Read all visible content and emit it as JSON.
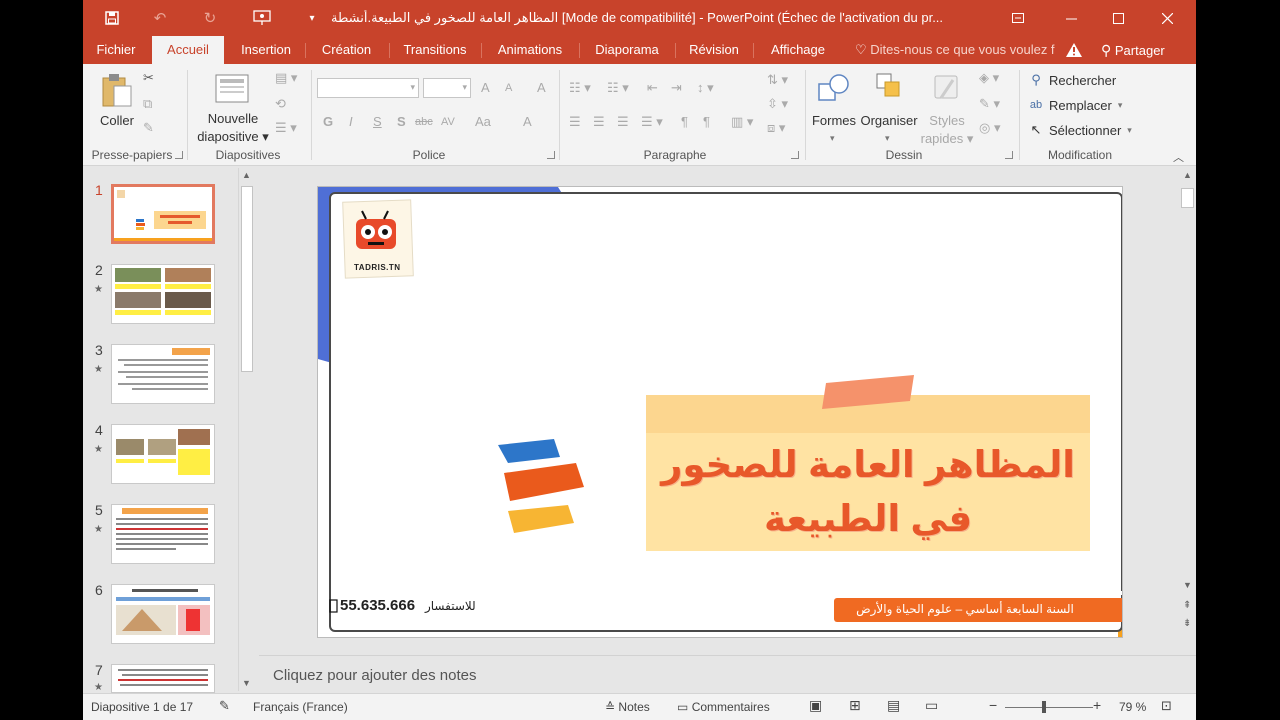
{
  "window": {
    "title": "المظاهر العامة للصخور في الطبيعة.أنشطة [Mode de compatibilité] - PowerPoint (Échec de l'activation du pr...",
    "accent": "#c8432b"
  },
  "qat": {
    "save_icon": "save-icon",
    "undo_icon": "undo-icon",
    "redo_icon": "redo-icon",
    "present_icon": "start-from-beginning-icon",
    "customize_icon": "customize-qat-icon"
  },
  "tabs": [
    {
      "label": "Fichier"
    },
    {
      "label": "Accueil"
    },
    {
      "label": "Insertion"
    },
    {
      "label": "Création"
    },
    {
      "label": "Transitions"
    },
    {
      "label": "Animations"
    },
    {
      "label": "Diaporama"
    },
    {
      "label": "Révision"
    },
    {
      "label": "Affichage"
    }
  ],
  "tellme": "Dites-nous ce que vous voulez f",
  "share": "Partager",
  "ribbon": {
    "clipboard": {
      "paste": "Coller",
      "label": "Presse-papiers"
    },
    "slides": {
      "new_line1": "Nouvelle",
      "new_line2": "diapositive",
      "label": "Diapositives"
    },
    "font": {
      "bold": "G",
      "italic": "I",
      "underline": "S",
      "shadow": "S",
      "strike": "abc",
      "spacing": "AV",
      "case": "Aa",
      "color": "A",
      "grow": "A",
      "shrink": "A",
      "clear": "A",
      "label": "Police"
    },
    "paragraph": {
      "label": "Paragraphe"
    },
    "drawing": {
      "shapes": "Formes",
      "arrange": "Organiser",
      "styles_line1": "Styles",
      "styles_line2": "rapides",
      "label": "Dessin"
    },
    "editing": {
      "find": "Rechercher",
      "replace": "Remplacer",
      "select": "Sélectionner",
      "label": "Modification"
    }
  },
  "thumbnails": [
    {
      "num": "1"
    },
    {
      "num": "2"
    },
    {
      "num": "3"
    },
    {
      "num": "4"
    },
    {
      "num": "5"
    },
    {
      "num": "6"
    },
    {
      "num": "7"
    }
  ],
  "slide": {
    "logo_text": "TADRIS.TN",
    "title_line1": "المظاهر العامة للصخور",
    "title_line2": "في الطبيعة",
    "contact_label": "للاستفسار",
    "phone": "55.635.666",
    "footer": "السنة السابعة أساسي – علوم الحياة والأرض"
  },
  "notes_placeholder": "Cliquez pour ajouter des notes",
  "status": {
    "slide_info": "Diapositive 1 de 17",
    "language": "Français (France)",
    "notes": "Notes",
    "comments": "Commentaires",
    "zoom": "79 %"
  }
}
